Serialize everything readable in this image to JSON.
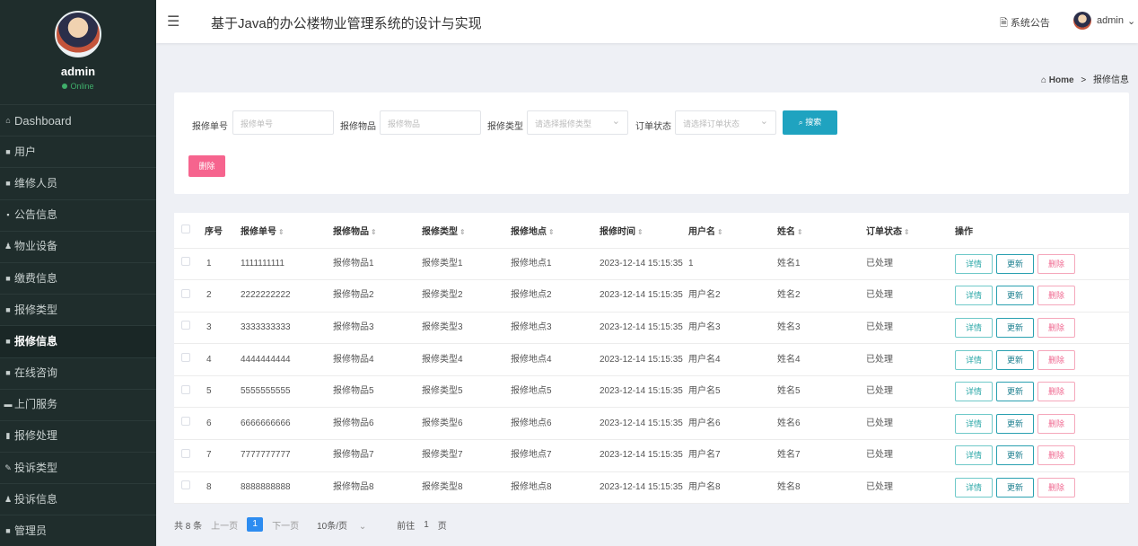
{
  "user": {
    "name": "admin",
    "status": "Online"
  },
  "menu": [
    {
      "label": "Dashboard",
      "icon": "⌂"
    },
    {
      "label": "用户",
      "icon": "■"
    },
    {
      "label": "维修人员",
      "icon": "■"
    },
    {
      "label": "公告信息",
      "icon": "▪"
    },
    {
      "label": "物业设备",
      "icon": "♟"
    },
    {
      "label": "缴费信息",
      "icon": "■"
    },
    {
      "label": "报修类型",
      "icon": "■"
    },
    {
      "label": "报修信息",
      "icon": "■"
    },
    {
      "label": "在线咨询",
      "icon": "■"
    },
    {
      "label": "上门服务",
      "icon": "▬"
    },
    {
      "label": "报修处理",
      "icon": "▮"
    },
    {
      "label": "投诉类型",
      "icon": "✎"
    },
    {
      "label": "投诉信息",
      "icon": "♟"
    },
    {
      "label": "管理员",
      "icon": "■"
    }
  ],
  "header": {
    "title": "基于Java的办公楼物业管理系统的设计与实现",
    "notice": "系统公告",
    "user": "admin"
  },
  "breadcrumb": {
    "home": "Home",
    "sep": ">",
    "current": "报修信息"
  },
  "search": {
    "order_no_label": "报修单号",
    "order_no_placeholder": "报修单号",
    "item_label": "报修物品",
    "item_placeholder": "报修物品",
    "type_label": "报修类型",
    "type_placeholder": "请选择报修类型",
    "status_label": "订单状态",
    "status_placeholder": "请选择订单状态",
    "search_button": "搜索",
    "delete_button": "删除"
  },
  "table": {
    "headers": [
      "序号",
      "报修单号",
      "报修物品",
      "报修类型",
      "报修地点",
      "报修时间",
      "用户名",
      "姓名",
      "订单状态",
      "操作"
    ],
    "rows": [
      [
        "1",
        "1111111111",
        "报修物品1",
        "报修类型1",
        "报修地点1",
        "2023-12-14 15:15:35",
        "1",
        "姓名1",
        "已处理"
      ],
      [
        "2",
        "2222222222",
        "报修物品2",
        "报修类型2",
        "报修地点2",
        "2023-12-14 15:15:35",
        "用户名2",
        "姓名2",
        "已处理"
      ],
      [
        "3",
        "3333333333",
        "报修物品3",
        "报修类型3",
        "报修地点3",
        "2023-12-14 15:15:35",
        "用户名3",
        "姓名3",
        "已处理"
      ],
      [
        "4",
        "4444444444",
        "报修物品4",
        "报修类型4",
        "报修地点4",
        "2023-12-14 15:15:35",
        "用户名4",
        "姓名4",
        "已处理"
      ],
      [
        "5",
        "5555555555",
        "报修物品5",
        "报修类型5",
        "报修地点5",
        "2023-12-14 15:15:35",
        "用户名5",
        "姓名5",
        "已处理"
      ],
      [
        "6",
        "6666666666",
        "报修物品6",
        "报修类型6",
        "报修地点6",
        "2023-12-14 15:15:35",
        "用户名6",
        "姓名6",
        "已处理"
      ],
      [
        "7",
        "7777777777",
        "报修物品7",
        "报修类型7",
        "报修地点7",
        "2023-12-14 15:15:35",
        "用户名7",
        "姓名7",
        "已处理"
      ],
      [
        "8",
        "8888888888",
        "报修物品8",
        "报修类型8",
        "报修地点8",
        "2023-12-14 15:15:35",
        "用户名8",
        "姓名8",
        "已处理"
      ]
    ],
    "actions": {
      "detail": "详情",
      "update": "更新",
      "delete": "删除"
    }
  },
  "pager": {
    "total": "共 8 条",
    "prev": "上一页",
    "page": "1",
    "next": "下一页",
    "size": "10条/页",
    "goto": "前往",
    "goto_page": "1",
    "page_unit": "页"
  },
  "colors": {
    "sidebar": "#1f2d2c",
    "accent": "#1fa3c0",
    "danger": "#f6648e",
    "online": "#3fae6a"
  }
}
